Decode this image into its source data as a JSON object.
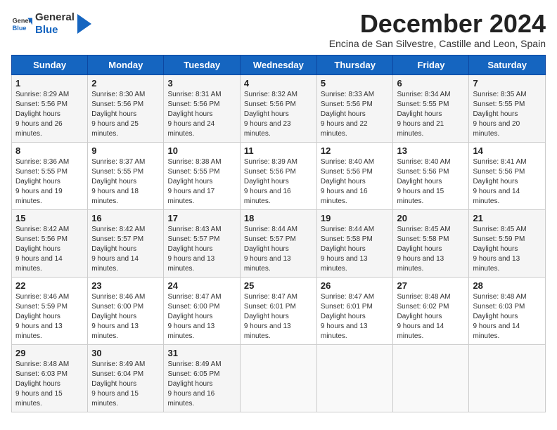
{
  "header": {
    "logo_general": "General",
    "logo_blue": "Blue",
    "month_title": "December 2024",
    "subtitle": "Encina de San Silvestre, Castille and Leon, Spain"
  },
  "weekdays": [
    "Sunday",
    "Monday",
    "Tuesday",
    "Wednesday",
    "Thursday",
    "Friday",
    "Saturday"
  ],
  "weeks": [
    [
      {
        "day": "1",
        "sunrise": "8:29 AM",
        "sunset": "5:56 PM",
        "daylight": "9 hours and 26 minutes."
      },
      {
        "day": "2",
        "sunrise": "8:30 AM",
        "sunset": "5:56 PM",
        "daylight": "9 hours and 25 minutes."
      },
      {
        "day": "3",
        "sunrise": "8:31 AM",
        "sunset": "5:56 PM",
        "daylight": "9 hours and 24 minutes."
      },
      {
        "day": "4",
        "sunrise": "8:32 AM",
        "sunset": "5:56 PM",
        "daylight": "9 hours and 23 minutes."
      },
      {
        "day": "5",
        "sunrise": "8:33 AM",
        "sunset": "5:56 PM",
        "daylight": "9 hours and 22 minutes."
      },
      {
        "day": "6",
        "sunrise": "8:34 AM",
        "sunset": "5:55 PM",
        "daylight": "9 hours and 21 minutes."
      },
      {
        "day": "7",
        "sunrise": "8:35 AM",
        "sunset": "5:55 PM",
        "daylight": "9 hours and 20 minutes."
      }
    ],
    [
      {
        "day": "8",
        "sunrise": "8:36 AM",
        "sunset": "5:55 PM",
        "daylight": "9 hours and 19 minutes."
      },
      {
        "day": "9",
        "sunrise": "8:37 AM",
        "sunset": "5:55 PM",
        "daylight": "9 hours and 18 minutes."
      },
      {
        "day": "10",
        "sunrise": "8:38 AM",
        "sunset": "5:55 PM",
        "daylight": "9 hours and 17 minutes."
      },
      {
        "day": "11",
        "sunrise": "8:39 AM",
        "sunset": "5:56 PM",
        "daylight": "9 hours and 16 minutes."
      },
      {
        "day": "12",
        "sunrise": "8:40 AM",
        "sunset": "5:56 PM",
        "daylight": "9 hours and 16 minutes."
      },
      {
        "day": "13",
        "sunrise": "8:40 AM",
        "sunset": "5:56 PM",
        "daylight": "9 hours and 15 minutes."
      },
      {
        "day": "14",
        "sunrise": "8:41 AM",
        "sunset": "5:56 PM",
        "daylight": "9 hours and 14 minutes."
      }
    ],
    [
      {
        "day": "15",
        "sunrise": "8:42 AM",
        "sunset": "5:56 PM",
        "daylight": "9 hours and 14 minutes."
      },
      {
        "day": "16",
        "sunrise": "8:42 AM",
        "sunset": "5:57 PM",
        "daylight": "9 hours and 14 minutes."
      },
      {
        "day": "17",
        "sunrise": "8:43 AM",
        "sunset": "5:57 PM",
        "daylight": "9 hours and 13 minutes."
      },
      {
        "day": "18",
        "sunrise": "8:44 AM",
        "sunset": "5:57 PM",
        "daylight": "9 hours and 13 minutes."
      },
      {
        "day": "19",
        "sunrise": "8:44 AM",
        "sunset": "5:58 PM",
        "daylight": "9 hours and 13 minutes."
      },
      {
        "day": "20",
        "sunrise": "8:45 AM",
        "sunset": "5:58 PM",
        "daylight": "9 hours and 13 minutes."
      },
      {
        "day": "21",
        "sunrise": "8:45 AM",
        "sunset": "5:59 PM",
        "daylight": "9 hours and 13 minutes."
      }
    ],
    [
      {
        "day": "22",
        "sunrise": "8:46 AM",
        "sunset": "5:59 PM",
        "daylight": "9 hours and 13 minutes."
      },
      {
        "day": "23",
        "sunrise": "8:46 AM",
        "sunset": "6:00 PM",
        "daylight": "9 hours and 13 minutes."
      },
      {
        "day": "24",
        "sunrise": "8:47 AM",
        "sunset": "6:00 PM",
        "daylight": "9 hours and 13 minutes."
      },
      {
        "day": "25",
        "sunrise": "8:47 AM",
        "sunset": "6:01 PM",
        "daylight": "9 hours and 13 minutes."
      },
      {
        "day": "26",
        "sunrise": "8:47 AM",
        "sunset": "6:01 PM",
        "daylight": "9 hours and 13 minutes."
      },
      {
        "day": "27",
        "sunrise": "8:48 AM",
        "sunset": "6:02 PM",
        "daylight": "9 hours and 14 minutes."
      },
      {
        "day": "28",
        "sunrise": "8:48 AM",
        "sunset": "6:03 PM",
        "daylight": "9 hours and 14 minutes."
      }
    ],
    [
      {
        "day": "29",
        "sunrise": "8:48 AM",
        "sunset": "6:03 PM",
        "daylight": "9 hours and 15 minutes."
      },
      {
        "day": "30",
        "sunrise": "8:49 AM",
        "sunset": "6:04 PM",
        "daylight": "9 hours and 15 minutes."
      },
      {
        "day": "31",
        "sunrise": "8:49 AM",
        "sunset": "6:05 PM",
        "daylight": "9 hours and 16 minutes."
      },
      null,
      null,
      null,
      null
    ]
  ],
  "labels": {
    "sunrise": "Sunrise:",
    "sunset": "Sunset:",
    "daylight": "Daylight hours"
  }
}
